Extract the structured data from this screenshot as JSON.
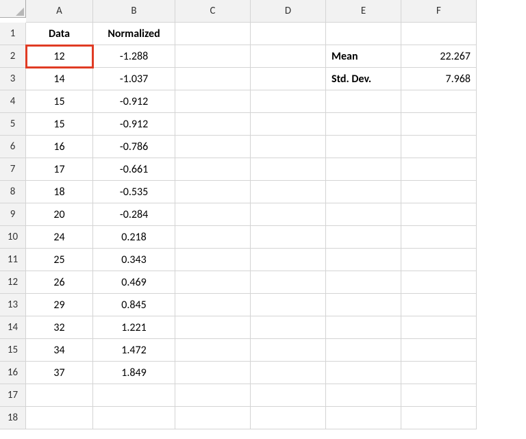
{
  "columns": [
    "A",
    "B",
    "C",
    "D",
    "E",
    "F"
  ],
  "headers": {
    "A": "Data",
    "B": "Normalized"
  },
  "rows": [
    {
      "n": 1,
      "A": "Data",
      "B": "Normalized",
      "E": "",
      "F": ""
    },
    {
      "n": 2,
      "A": "12",
      "B": "-1.288",
      "E": "Mean",
      "F": "22.267"
    },
    {
      "n": 3,
      "A": "14",
      "B": "-1.037",
      "E": "Std. Dev.",
      "F": "7.968"
    },
    {
      "n": 4,
      "A": "15",
      "B": "-0.912"
    },
    {
      "n": 5,
      "A": "15",
      "B": "-0.912"
    },
    {
      "n": 6,
      "A": "16",
      "B": "-0.786"
    },
    {
      "n": 7,
      "A": "17",
      "B": "-0.661"
    },
    {
      "n": 8,
      "A": "18",
      "B": "-0.535"
    },
    {
      "n": 9,
      "A": "20",
      "B": "-0.284"
    },
    {
      "n": 10,
      "A": "24",
      "B": "0.218"
    },
    {
      "n": 11,
      "A": "25",
      "B": "0.343"
    },
    {
      "n": 12,
      "A": "26",
      "B": "0.469"
    },
    {
      "n": 13,
      "A": "29",
      "B": "0.845"
    },
    {
      "n": 14,
      "A": "32",
      "B": "1.221"
    },
    {
      "n": 15,
      "A": "34",
      "B": "1.472"
    },
    {
      "n": 16,
      "A": "37",
      "B": "1.849"
    },
    {
      "n": 17
    },
    {
      "n": 18
    }
  ],
  "selected_cell": "A2",
  "stats": {
    "mean_label": "Mean",
    "mean": "22.267",
    "std_label": "Std. Dev.",
    "std": "7.968"
  }
}
